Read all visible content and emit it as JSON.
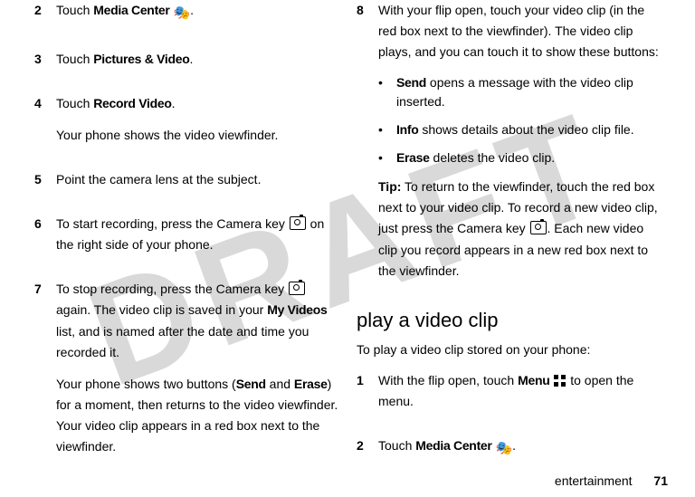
{
  "watermark": "DRAFT",
  "left": {
    "steps": [
      {
        "num": "2",
        "parts": [
          "Touch ",
          "Media Center",
          " ",
          "@multimedia",
          "."
        ]
      },
      {
        "num": "3",
        "parts": [
          "Touch ",
          "Pictures & Video",
          "."
        ]
      },
      {
        "num": "4",
        "parts": [
          "Touch ",
          "Record Video",
          "."
        ],
        "after": [
          "Your phone shows the video viewfinder."
        ]
      },
      {
        "num": "5",
        "parts": [
          "Point the camera lens at the subject."
        ]
      },
      {
        "num": "6",
        "parts": [
          "To start recording, press the Camera key ",
          "@camera",
          " on the right side of your phone."
        ]
      },
      {
        "num": "7",
        "parts": [
          "To stop recording, press the Camera key ",
          "@camera",
          " again. The video clip is saved in your ",
          "My Videos",
          " list, and is named after the date and time you recorded it."
        ],
        "after": [
          "Your phone shows two buttons (",
          "Send",
          " and ",
          "Erase",
          ") for a moment, then returns to the video viewfinder. Your video clip appears in a red box next to the viewfinder."
        ]
      }
    ]
  },
  "right": {
    "step8": {
      "num": "8",
      "intro": "With your flip open, touch your video clip (in the red box next to the viewfinder). The video clip plays, and you can touch it to show these buttons:",
      "bullets": [
        {
          "bold": "Send",
          "rest": " opens a message with the video clip inserted."
        },
        {
          "bold": "Info",
          "rest": " shows details about the video clip file."
        },
        {
          "bold": "Erase",
          "rest": " deletes the video clip."
        }
      ],
      "tip_label": "Tip:",
      "tip_parts": [
        " To return to the viewfinder, touch the red box next to your video clip. To record a new video clip, just press the Camera key ",
        "@camera",
        ". Each new video clip you record appears in a new red box next to the viewfinder."
      ]
    },
    "heading": "play a video clip",
    "intro": "To play a video clip stored on your phone:",
    "steps": [
      {
        "num": "1",
        "parts": [
          "With the flip open, touch ",
          "Menu",
          " ",
          "@grid",
          " to open the menu."
        ]
      },
      {
        "num": "2",
        "parts": [
          "Touch ",
          "Media Center",
          " ",
          "@multimedia",
          "."
        ]
      }
    ]
  },
  "footer": {
    "section": "entertainment",
    "page": "71"
  }
}
